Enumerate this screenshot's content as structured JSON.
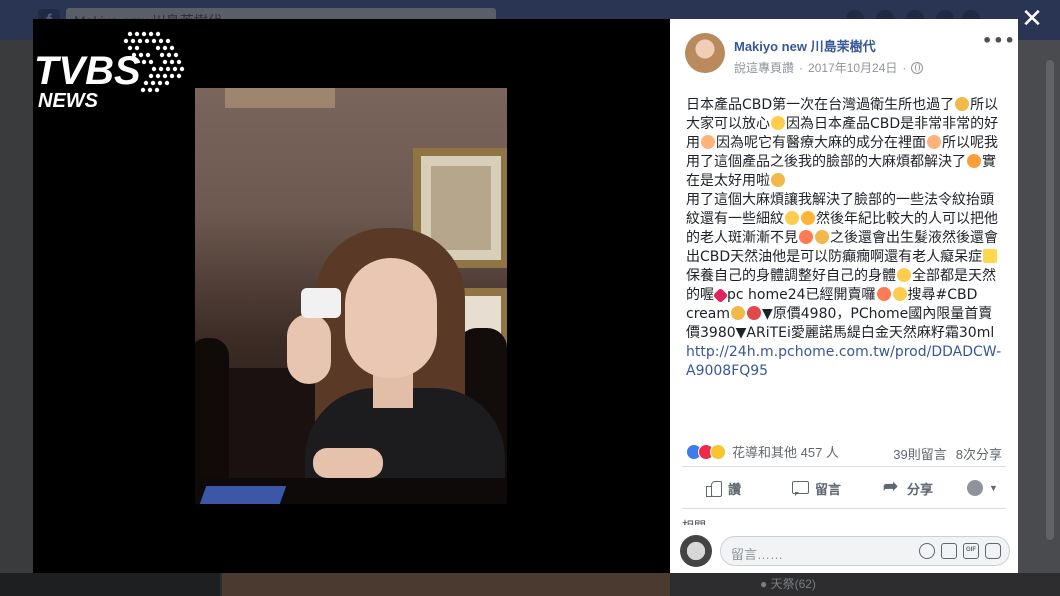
{
  "background": {
    "search_value": "Makiyo new 川島茉樹代",
    "comments_hint": "● 天祭(62)"
  },
  "viewer": {
    "close_label": "✕",
    "logo_text": "TVBS",
    "logo_sub": "NEWS"
  },
  "post": {
    "page_name": "Makiyo new 川島茉樹代",
    "meta_like": "說這專頁讚",
    "meta_sep": "·",
    "meta_date": "2017年10月24日",
    "meta_sep2": "·",
    "more_label": "•••",
    "body": {
      "p1a": "日本產品CBD第一次在台灣過衛生所也過了",
      "p1b": "所以大家可以放心",
      "p1c": "因為日本產品CBD是非常非常的好用",
      "p1d": "因為呢它有醫療大麻的成分在裡面",
      "p1e": "所以呢我用了這個產品之後我的臉部的大麻煩都解決了",
      "p1f": "實在是太好用啦",
      "p2a": "用了這個大麻煩讓我解決了臉部的一些法令紋抬頭紋還有一些細紋",
      "p2b": "然後年紀比較大的人可以把他的老人斑漸漸不見",
      "p2c": "之後還會出生髮液然後還會出CBD天然油他是可以防癲癇啊還有老人癡呆症",
      "p2d": "保養自己的身體調整好自己的身體",
      "p2e": "全部都是天然的喔",
      "p2f": "pc home24已經開賣囉",
      "p2g": "搜尋#CBD cream",
      "p2h": "▼原價4980，PChome國內限量首賣價3980▼ARiTEi愛麗諾馬緹白金天然麻籽霜30ml ",
      "link": "http://24h.m.pchome.com.tw/prod/DDADCW-A9008FQ95"
    },
    "reactions_label": "花導和其他 457 人",
    "comments_count": "39則留言",
    "shares_count": "8次分享",
    "actions": {
      "like": "讚",
      "comment": "留言",
      "share": "分享"
    },
    "related_label": "相關",
    "composer_placeholder": "留言……"
  },
  "colors": {
    "link": "#365899",
    "brand_bar": "#2a3553",
    "like_blue": "#3b7bea"
  },
  "icons": [
    "search-icon",
    "close-icon",
    "globe-icon",
    "more-icon",
    "like-icon",
    "comment-icon",
    "share-icon",
    "audience-icon",
    "emoji-icon",
    "camera-icon",
    "gif-icon",
    "sticker-icon"
  ]
}
